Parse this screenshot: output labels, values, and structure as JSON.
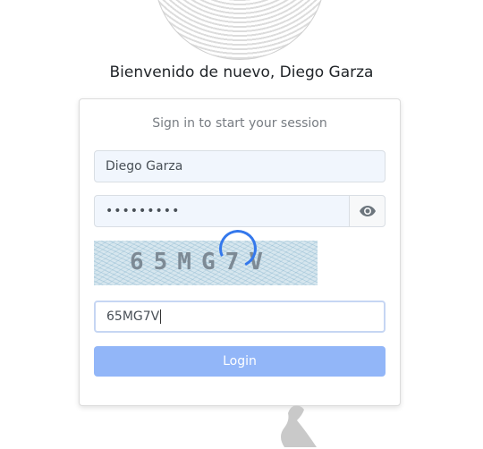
{
  "welcome": "Bienvenido de nuevo, Diego Garza",
  "login_box": {
    "message": "Sign in to start your session",
    "username_value": "Diego Garza",
    "password_masked": "•••••••••",
    "captcha_text": "65MG7V",
    "captcha_input_value": "65MG7V",
    "login_label": "Login"
  },
  "icons": {
    "avatar": "user-avatar",
    "eye": "eye-icon",
    "spinner": "loading-spinner-icon"
  },
  "colors": {
    "accent": "#3478ec",
    "login_button": "#92b6f8",
    "input_bg": "#f1f6fd"
  }
}
